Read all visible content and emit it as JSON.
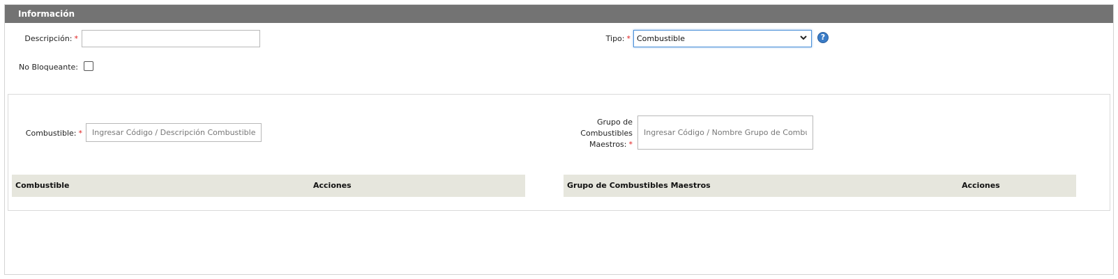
{
  "panel": {
    "title": "Información"
  },
  "form": {
    "descripcion": {
      "label": "Descripción:",
      "required_mark": "*",
      "value": ""
    },
    "tipo": {
      "label": "Tipo:",
      "required_mark": "*",
      "selected": "Combustible",
      "help_glyph": "?"
    },
    "no_bloqueante": {
      "label": "No Bloqueante:",
      "checked": false
    }
  },
  "filters": {
    "combustible": {
      "label": "Combustible:",
      "required_mark": "*",
      "placeholder": "Ingresar Código / Descripción Combustible"
    },
    "grupo": {
      "label_lines": [
        "Grupo de",
        "Combustibles",
        "Maestros:"
      ],
      "required_mark": "*",
      "placeholder": "Ingresar Código / Nombre Grupo de Combustibles"
    }
  },
  "tables": {
    "combustible": {
      "columns": [
        "Combustible",
        "Acciones"
      ]
    },
    "grupo": {
      "columns": [
        "Grupo de Combustibles Maestros",
        "Acciones"
      ]
    }
  },
  "icons": {
    "dropdown": "chevron-down-icon",
    "help": "help-icon"
  },
  "colors": {
    "header_bg": "#737373",
    "required": "#e02020",
    "table_header_bg": "#e6e6dd",
    "help_icon": "#3a7cc7"
  }
}
